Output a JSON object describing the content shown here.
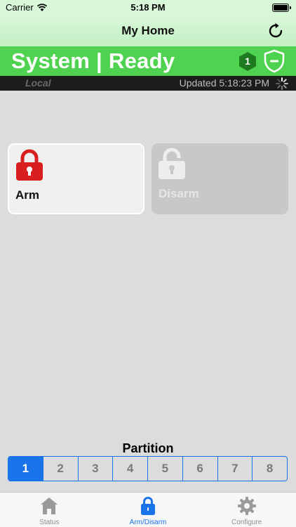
{
  "status_bar": {
    "carrier": "Carrier",
    "time": "5:18 PM"
  },
  "nav": {
    "title": "My Home",
    "refresh_icon": "refresh-icon"
  },
  "banner": {
    "title": "System | Ready",
    "partition_badge": "1",
    "badge_icon": "hexagon-badge-icon",
    "shield_icon": "shield-disarmed-icon"
  },
  "info": {
    "connection": "Local",
    "updated": "Updated 5:18:23 PM",
    "spinner_icon": "loading-spinner-icon"
  },
  "actions": {
    "arm": {
      "label": "Arm",
      "icon": "locked-padlock-icon"
    },
    "disarm": {
      "label": "Disarm",
      "icon": "unlocked-padlock-icon"
    }
  },
  "partition": {
    "title": "Partition",
    "options": [
      "1",
      "2",
      "3",
      "4",
      "5",
      "6",
      "7",
      "8"
    ],
    "selected": "1"
  },
  "tabs": [
    {
      "label": "Status",
      "icon": "house-icon"
    },
    {
      "label": "Arm/Disarm",
      "icon": "padlock-icon",
      "active": true
    },
    {
      "label": "Configure",
      "icon": "gear-icon"
    }
  ],
  "colors": {
    "accent": "#1a73e8",
    "ready_green": "#4fd24f",
    "arm_red": "#d81e1e"
  }
}
